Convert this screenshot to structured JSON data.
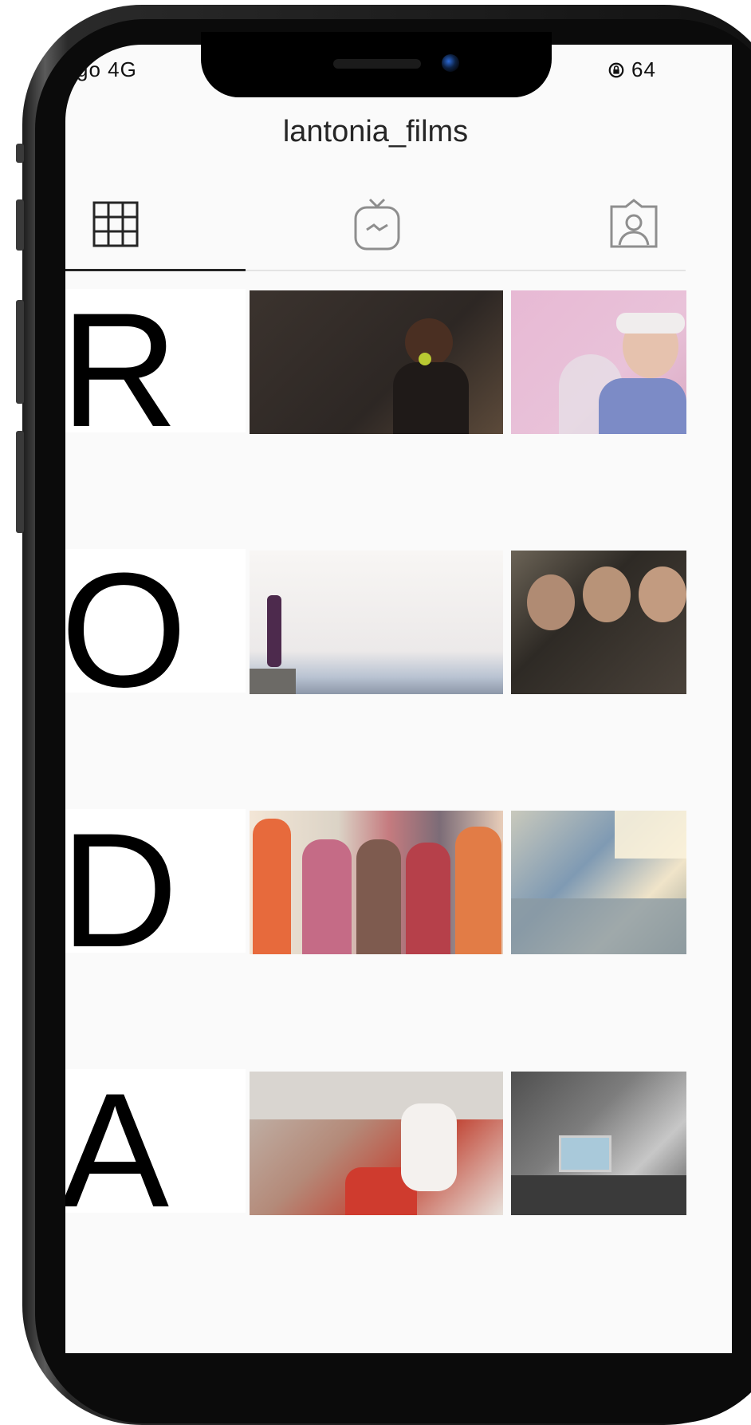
{
  "status_bar": {
    "carrier": "go  4G",
    "battery": "64"
  },
  "profile": {
    "username": "lantonia_films"
  },
  "tabs": [
    {
      "icon": "grid-icon",
      "active": true
    },
    {
      "icon": "igtv-icon",
      "active": false
    },
    {
      "icon": "tagged-icon",
      "active": false
    }
  ],
  "grid": {
    "letters": [
      "R",
      "O",
      "D",
      "A"
    ],
    "photos": [
      "singer-on-stage-photo",
      "woman-pink-background-photo",
      "man-on-cliff-photo",
      "women-in-headscarves-photo",
      "group-of-women-photo",
      "mosaic-bench-photo",
      "basketball-players-photo",
      "office-desks-photo"
    ]
  },
  "colors": {
    "frame": "#111111",
    "background": "#fafafa",
    "text": "#262626"
  }
}
